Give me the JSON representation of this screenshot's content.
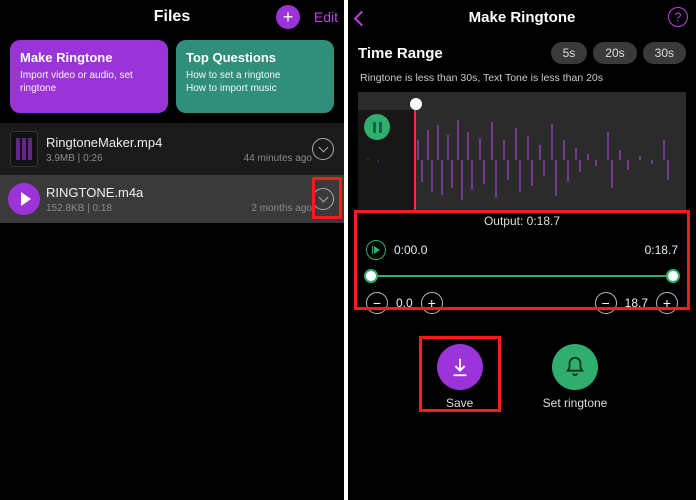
{
  "left": {
    "title": "Files",
    "edit": "Edit",
    "cards": [
      {
        "title": "Make Ringtone",
        "sub": "Import video or audio, set ringtone"
      },
      {
        "title": "Top Questions",
        "sub": "How to set a ringtone\nHow to import music"
      }
    ],
    "rows": [
      {
        "name": "RingtoneMaker.mp4",
        "size": "3.9MB",
        "dur": "0:26",
        "ago": "44 minutes ago"
      },
      {
        "name": "RINGTONE.m4a",
        "size": "152.8KB",
        "dur": "0:18",
        "ago": "2 months ago"
      }
    ]
  },
  "right": {
    "title": "Make Ringtone",
    "time_range_label": "Time Range",
    "presets": [
      "5s",
      "20s",
      "30s"
    ],
    "hint": "Ringtone is less than 30s, Text Tone is less than 20s",
    "output_label": "Output:",
    "output_value": "0:18.7",
    "trim": {
      "start": "0:00.0",
      "end": "0:18.7",
      "start_val": "0.0",
      "end_val": "18.7"
    },
    "actions": {
      "save": "Save",
      "ring": "Set ringtone"
    }
  }
}
